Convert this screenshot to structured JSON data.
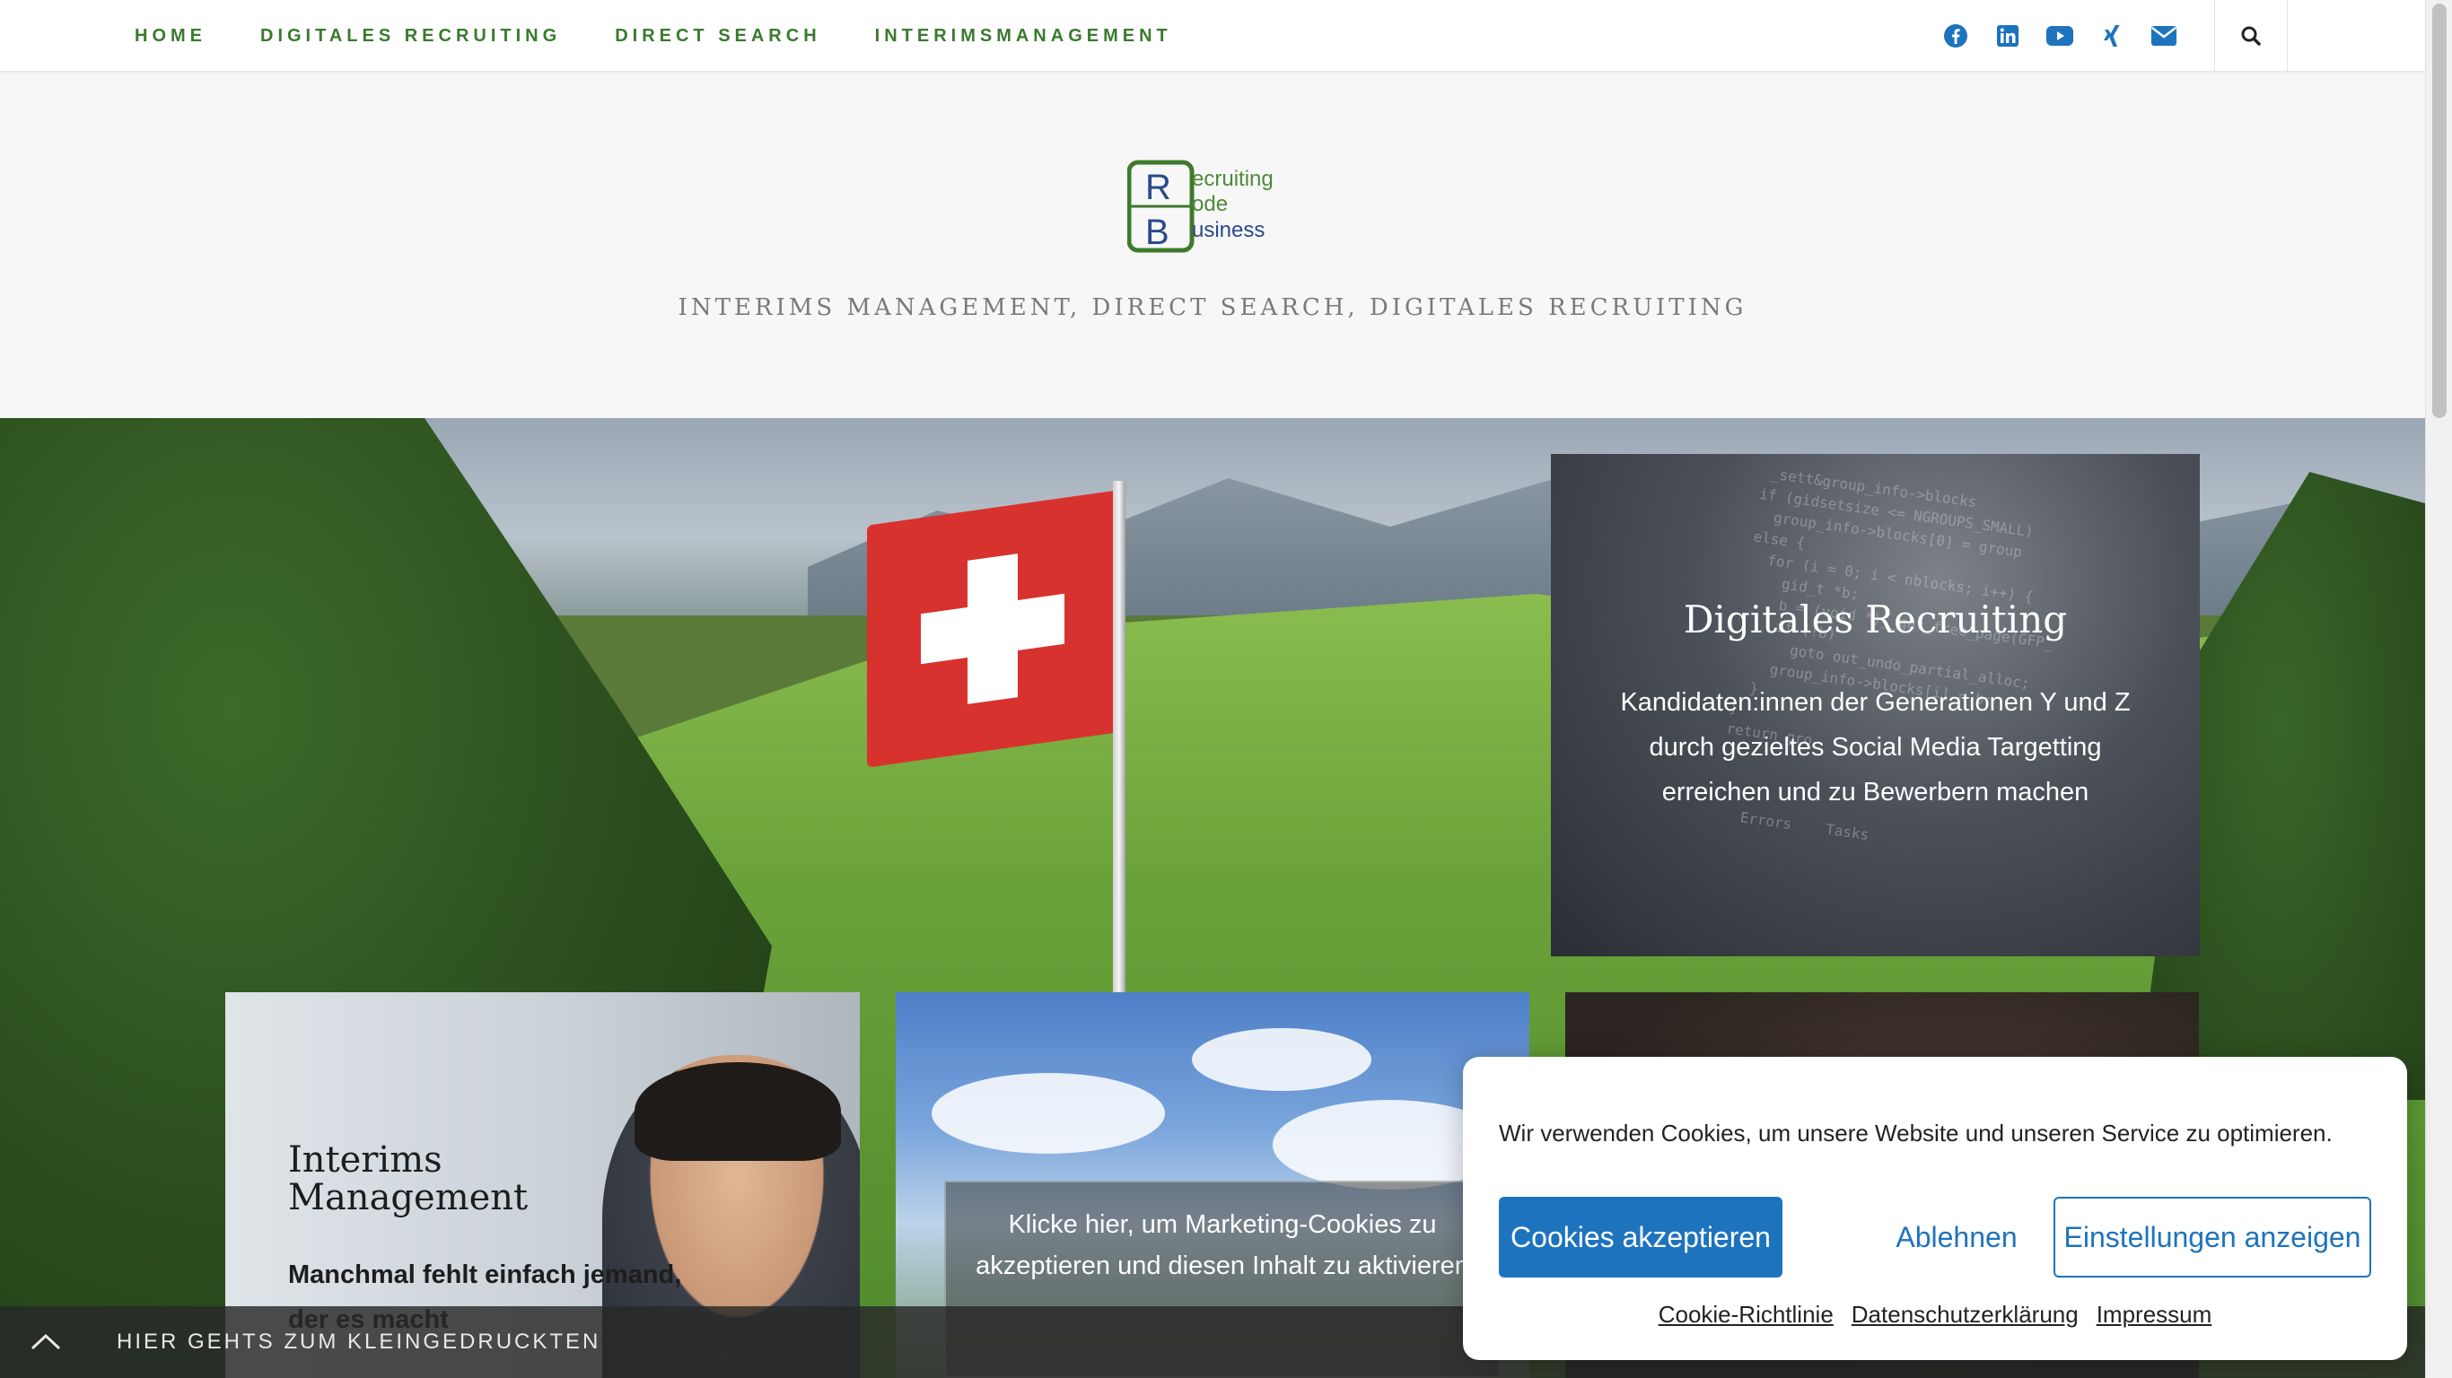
{
  "nav": {
    "items": [
      {
        "label": "HOME"
      },
      {
        "label": "DIGITALES RECRUITING"
      },
      {
        "label": "DIRECT SEARCH"
      },
      {
        "label": "INTERIMSMANAGEMENT"
      }
    ],
    "social_icons": [
      "facebook-icon",
      "linkedin-icon",
      "youtube-icon",
      "xing-icon",
      "envelope-icon"
    ],
    "search_icon": "search-icon"
  },
  "logo": {
    "letters": [
      "R",
      "B"
    ],
    "lines": [
      "ecruiting",
      "ode",
      "usiness"
    ],
    "colors": {
      "frame": "#3f7a2c",
      "text_green": "#4d8a3a",
      "text_blue": "#2a4a8c"
    }
  },
  "tagline": "INTERIMS MANAGEMENT, DIRECT SEARCH, DIGITALES RECRUITING",
  "cards": {
    "digitales_recruiting": {
      "title": "Digitales Recruiting",
      "text": "Kandidaten:innen der Generationen Y und Z durch gezieltes Social Media Targetting erreichen und zu Bewerbern machen"
    },
    "interims": {
      "title": "Interims Management",
      "text": "Manchmal fehlt einfach jemand, der es macht"
    },
    "direct_search": {
      "overlay_text": "Klicke hier, um Marketing-Cookies zu akzeptieren und diesen Inhalt zu aktivieren"
    }
  },
  "footer_bar": {
    "label": "HIER GEHTS ZUM KLEINGEDRUCKTEN"
  },
  "cookie_banner": {
    "message": "Wir verwenden Cookies, um unsere Website und unseren Service zu optimieren.",
    "accept": "Cookies akzeptieren",
    "deny": "Ablehnen",
    "preferences": "Einstellungen anzeigen",
    "links": [
      "Cookie-Richtlinie",
      "Datenschutzerklärung",
      "Impressum"
    ]
  },
  "colors": {
    "nav_green": "#3a7a2e",
    "cookie_blue": "#1e73be",
    "social_blue": "#1e73be"
  }
}
